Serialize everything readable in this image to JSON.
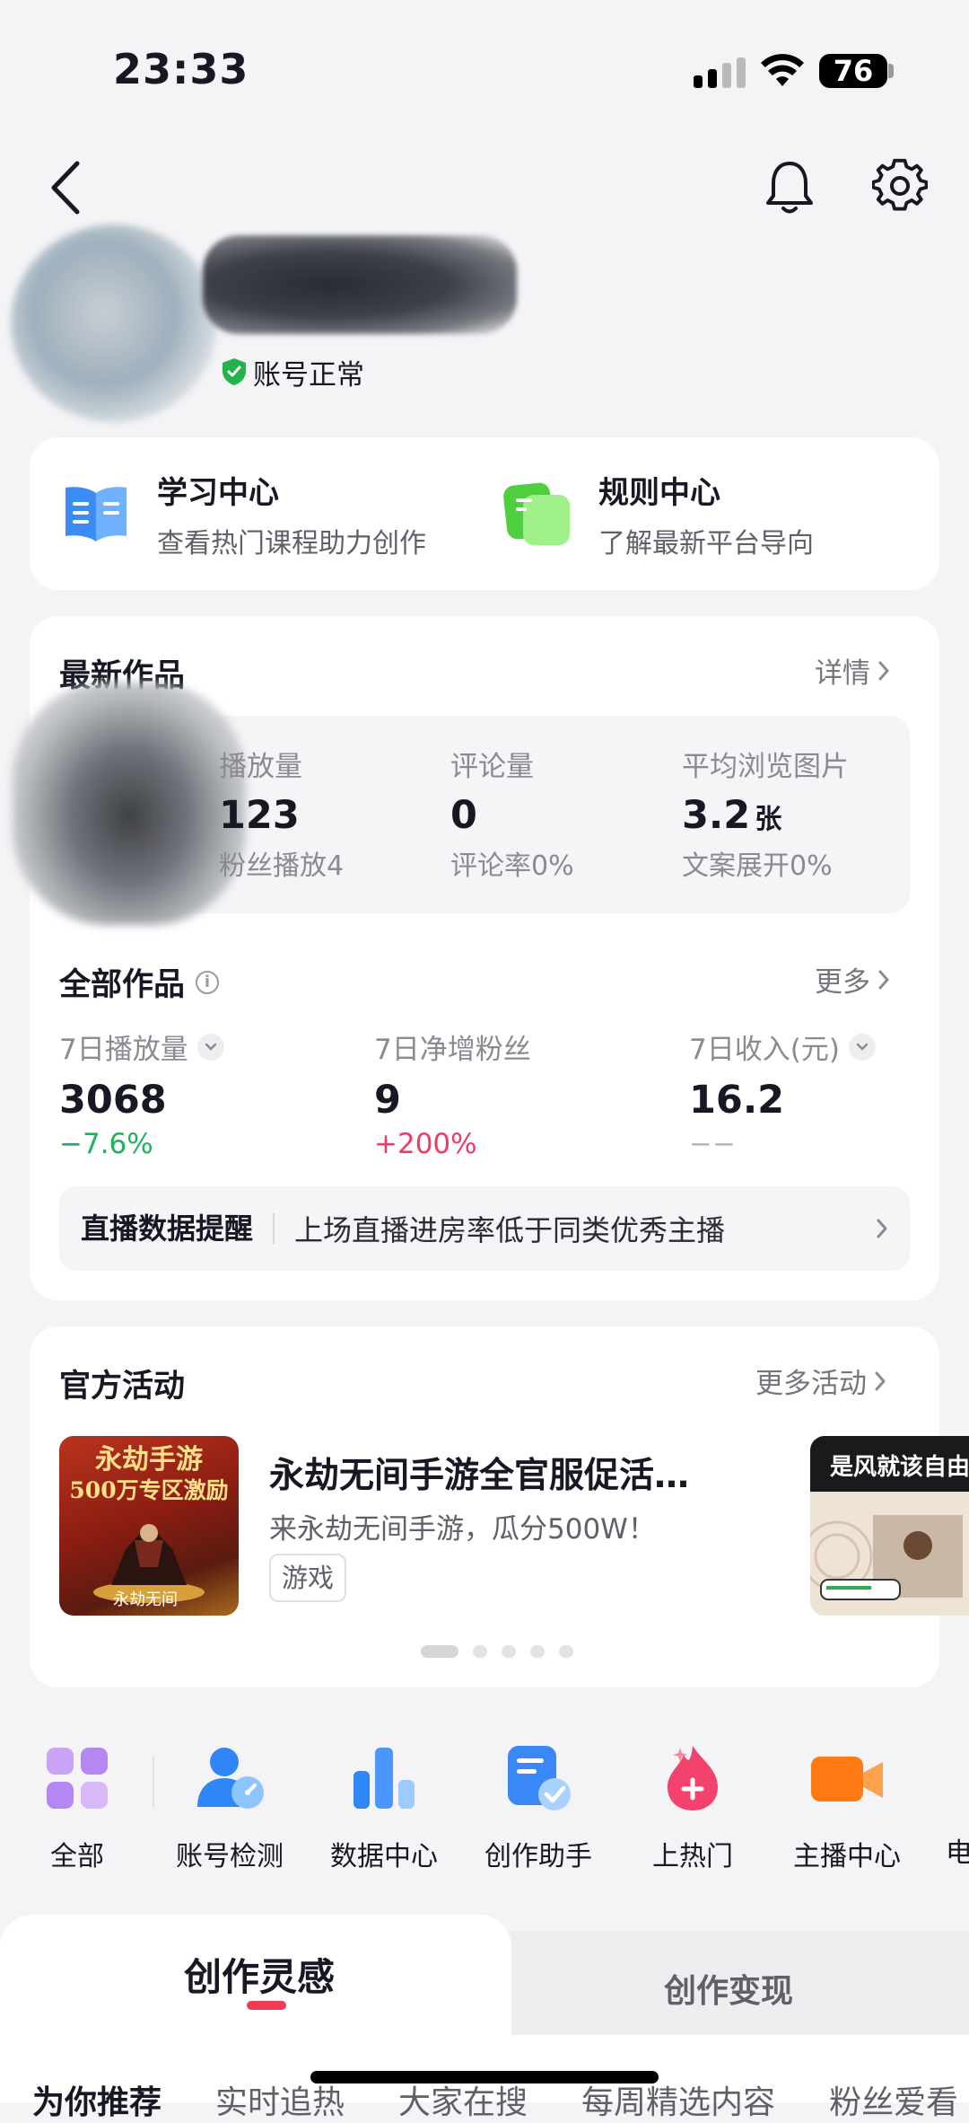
{
  "status_bar": {
    "time": "23:33",
    "battery": "76"
  },
  "profile": {
    "account_status": "账号正常"
  },
  "learn": [
    {
      "title": "学习中心",
      "subtitle": "查看热门课程助力创作"
    },
    {
      "title": "规则中心",
      "subtitle": "了解最新平台导向"
    }
  ],
  "latest": {
    "title": "最新作品",
    "link": "详情",
    "metrics": [
      {
        "label": "播放量",
        "value": "123",
        "unit": "",
        "sub": "粉丝播放4"
      },
      {
        "label": "评论量",
        "value": "0",
        "unit": "",
        "sub": "评论率0%"
      },
      {
        "label": "平均浏览图片",
        "value": "3.2",
        "unit": "张",
        "sub": "文案展开0%"
      }
    ]
  },
  "all_works": {
    "title": "全部作品",
    "info": "i",
    "link": "更多",
    "metrics": [
      {
        "label": "7日播放量",
        "value": "3068",
        "change": "−7.6%"
      },
      {
        "label": "7日净增粉丝",
        "value": "9",
        "change": "+200%"
      },
      {
        "label": "7日收入(元)",
        "value": "16.2",
        "change": "−−"
      }
    ],
    "live": {
      "title": "直播数据提醒",
      "text": "上场直播进房率低于同类优秀主播"
    }
  },
  "events": {
    "title": "官方活动",
    "link": "更多活动",
    "item": {
      "title": "永劫无间手游全官服促活…",
      "desc": "来永劫无间手游，瓜分500W！",
      "tag": "游戏",
      "thumb_line1": "永劫手游",
      "thumb_line2": "500万专区激励",
      "thumb_logo": "永劫无间"
    },
    "next_item_text": "是风就该自由",
    "pager_count": 5,
    "pager_active": 0
  },
  "tools": [
    {
      "label": "全部",
      "icon": "grid-icon"
    },
    {
      "label": "账号检测",
      "icon": "account-check-icon"
    },
    {
      "label": "数据中心",
      "icon": "bar-chart-icon"
    },
    {
      "label": "创作助手",
      "icon": "document-check-icon"
    },
    {
      "label": "上热门",
      "icon": "flame-plus-icon"
    },
    {
      "label": "主播中心",
      "icon": "camera-icon"
    },
    {
      "label": "电",
      "icon": "partial-icon"
    }
  ],
  "bottom_tabs": {
    "active": "创作灵感",
    "inactive": "创作变现",
    "subtabs": [
      "为你推荐",
      "实时追热",
      "大家在搜",
      "每周精选内容",
      "粉丝爱看"
    ]
  },
  "colors": {
    "accent_red": "#f03b54",
    "positive": "#20b25f",
    "negative": "#f03b64",
    "verified_green": "#22b34a"
  }
}
